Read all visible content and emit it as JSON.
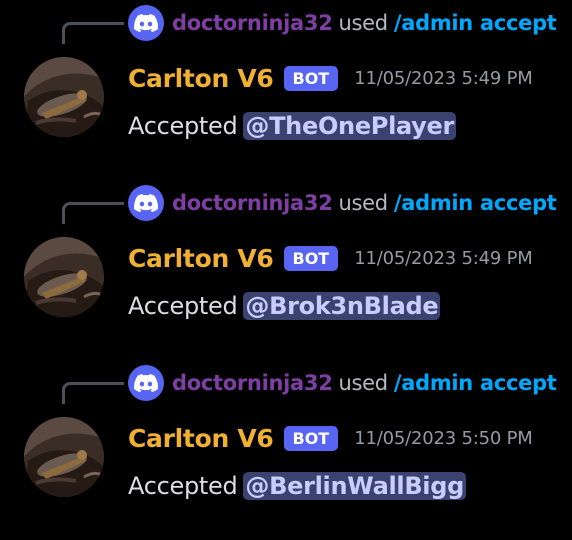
{
  "accent": "#5865f2",
  "messages": [
    {
      "reply": {
        "user": "doctorninja32",
        "used": "used",
        "command": "/admin accept",
        "icon": "discord-icon"
      },
      "author": "Carlton V6",
      "tag": "BOT",
      "timestamp": "11/05/2023 5:49 PM",
      "text": "Accepted",
      "mention": "@TheOnePlayer"
    },
    {
      "reply": {
        "user": "doctorninja32",
        "used": "used",
        "command": "/admin accept",
        "icon": "discord-icon"
      },
      "author": "Carlton V6",
      "tag": "BOT",
      "timestamp": "11/05/2023 5:49 PM",
      "text": "Accepted",
      "mention": "@Brok3nBlade"
    },
    {
      "reply": {
        "user": "doctorninja32",
        "used": "used",
        "command": "/admin accept",
        "icon": "discord-icon"
      },
      "author": "Carlton V6",
      "tag": "BOT",
      "timestamp": "11/05/2023 5:50 PM",
      "text": "Accepted",
      "mention": "@BerlinWallBigg"
    }
  ]
}
